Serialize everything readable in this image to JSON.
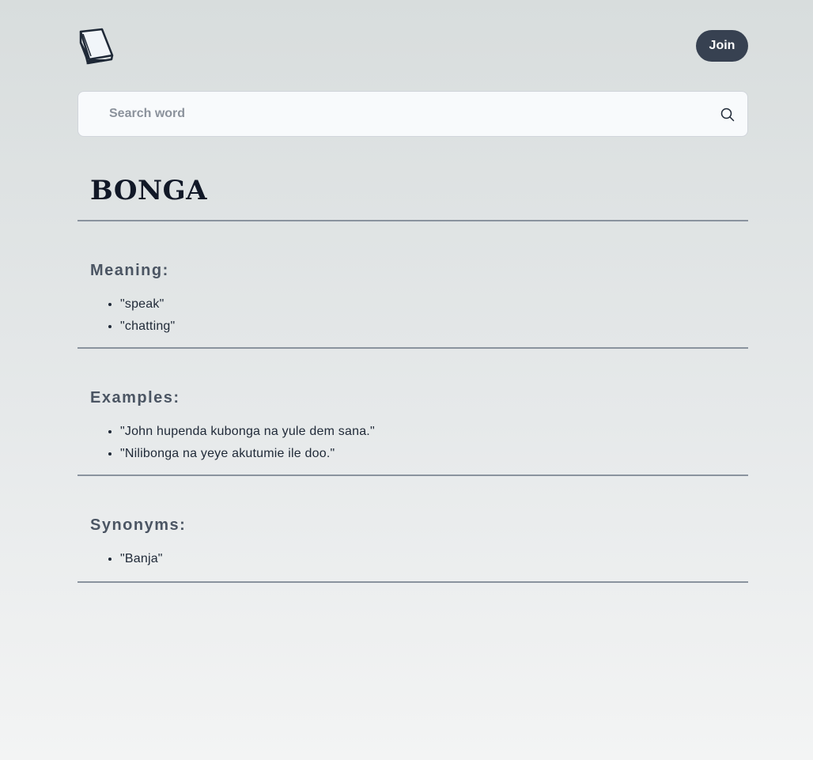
{
  "header": {
    "logo_icon": "book-icon",
    "join_label": "Join"
  },
  "search": {
    "placeholder": "Search word",
    "value": "",
    "icon": "search-icon"
  },
  "word": {
    "title": "BONGA"
  },
  "sections": {
    "meaning": {
      "heading": "Meaning:",
      "items": [
        "\"speak\"",
        "\"chatting\""
      ]
    },
    "examples": {
      "heading": "Examples:",
      "items": [
        "\"John hupenda kubonga na yule dem sana.\"",
        "\"Nilibonga na yeye akutumie ile doo.\""
      ]
    },
    "synonyms": {
      "heading": "Synonyms:",
      "items": [
        "\"Banja\""
      ]
    }
  },
  "colors": {
    "accent_button": "#374151",
    "divider": "#8a939e",
    "heading_text": "#4b5563"
  }
}
